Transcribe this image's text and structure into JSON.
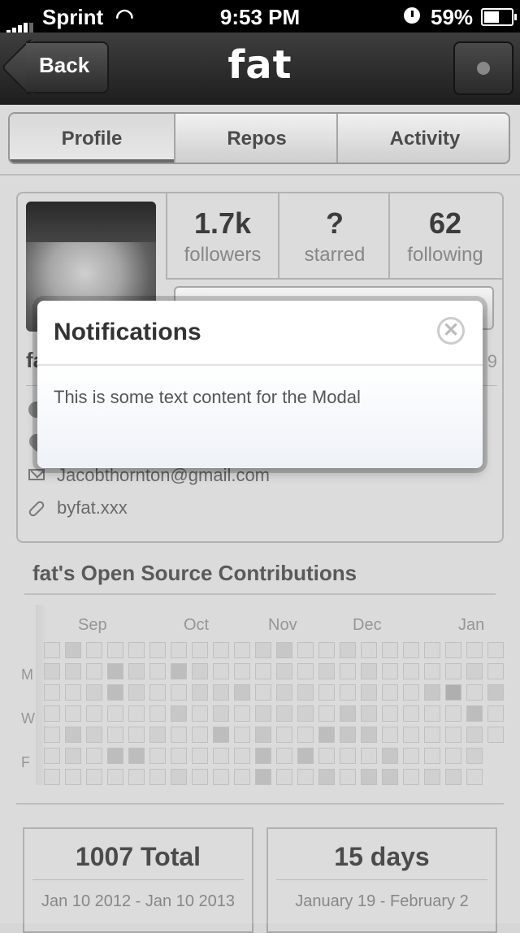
{
  "status_bar": {
    "carrier": "Sprint",
    "time": "9:53 PM",
    "battery_percent": "59%",
    "battery_level": 0.59,
    "icons": [
      "signal-bars-icon",
      "wifi-icon",
      "clock-icon",
      "battery-icon"
    ]
  },
  "nav": {
    "back_label": "Back",
    "title": "fat",
    "action_icon": "dot-icon"
  },
  "tabs": [
    {
      "label": "Profile",
      "active": true
    },
    {
      "label": "Repos",
      "active": false
    },
    {
      "label": "Activity",
      "active": false
    }
  ],
  "profile": {
    "stats": [
      {
        "value": "1.7k",
        "label": "followers"
      },
      {
        "value": "?",
        "label": "starred"
      },
      {
        "value": "62",
        "label": "following"
      }
    ],
    "name_partial": "fa",
    "joined_partial": "9",
    "email": "Jacobthornton@gmail.com",
    "website": "byfat.xxx",
    "detail_icons": [
      "github-icon",
      "location-pin-icon",
      "mail-icon",
      "link-icon"
    ]
  },
  "contributions": {
    "title": "fat's Open Source Contributions",
    "months": [
      "Sep",
      "Oct",
      "Nov",
      "Dec",
      "Jan"
    ],
    "day_labels": [
      "M",
      "W",
      "F"
    ]
  },
  "summary": [
    {
      "big": "1007 Total",
      "sub": "Jan 10 2012 - Jan 10 2013"
    },
    {
      "big": "15 days",
      "sub": "January 19 - February 2"
    }
  ],
  "modal": {
    "title": "Notifications",
    "body": "This is some text content for the Modal",
    "close_icon": "close-circle-icon"
  },
  "colors": {
    "nav_bg": "#2b2b2b",
    "page_bg": "#d6d6d6",
    "modal_bg": "#ffffff"
  }
}
